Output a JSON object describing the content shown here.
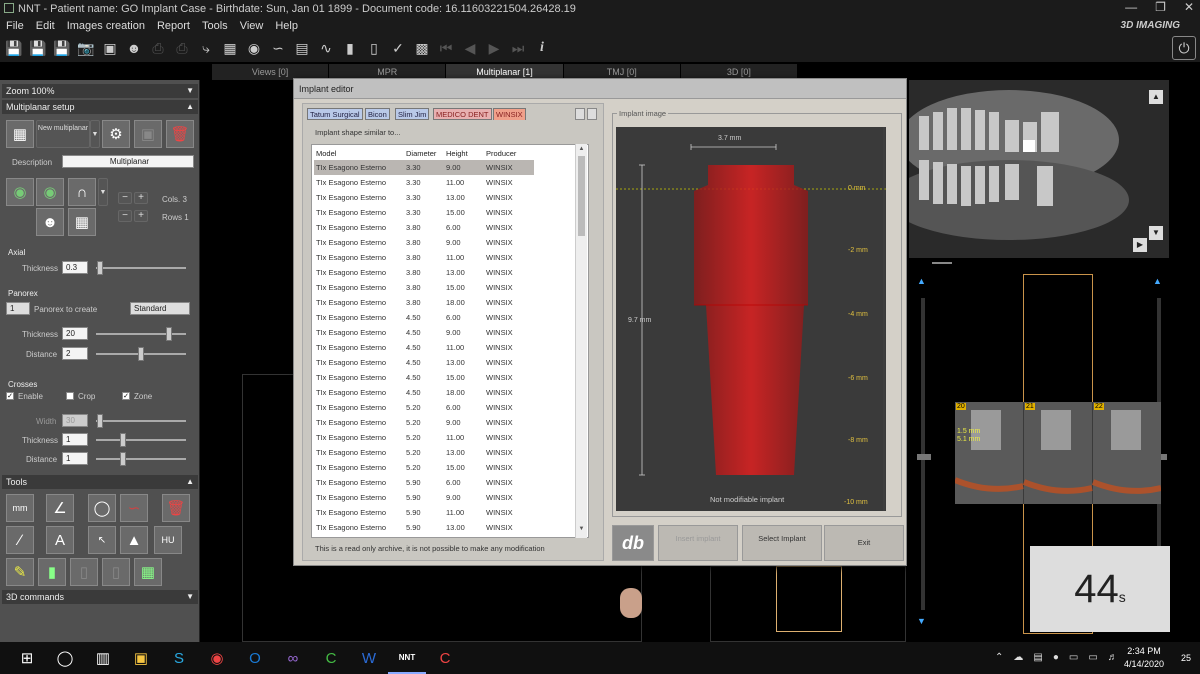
{
  "window": {
    "title": "NNT - Patient name: GO Implant Case - Birthdate: Sun, Jan 01 1899 - Document code: 16.11603221504.26428.19",
    "brand": "3D IMAGING",
    "minimize": "—",
    "restore": "❐",
    "close": "✕"
  },
  "menu": [
    "File",
    "Edit",
    "Images creation",
    "Report",
    "Tools",
    "View",
    "Help"
  ],
  "view_tabs": [
    "Views [0]",
    "MPR",
    "Multiplanar [1]",
    "TMJ [0]",
    "3D [0]"
  ],
  "left_panel": {
    "zoom": "Zoom 100%",
    "multiplanar_setup": "Multiplanar setup",
    "new_multiplanar": "New multiplanar",
    "description_label": "Description",
    "description_value": "Multiplanar",
    "cols_label": "Cols.",
    "cols_value": "3",
    "rows_label": "Rows",
    "rows_value": "1",
    "axial": "Axial",
    "thickness_label": "Thickness",
    "axial_thickness": "0.3",
    "panorex": "Panorex",
    "panorex_count": "1",
    "panorex_to_create": "Panorex to create",
    "panorex_type": "Standard",
    "panorex_thickness": "20",
    "distance_label": "Distance",
    "panorex_distance": "2",
    "crosses": "Crosses",
    "enable": "Enable",
    "crop": "Crop",
    "zone": "Zone",
    "width_label": "Width",
    "crosses_width": "30",
    "crosses_thickness": "1",
    "crosses_distance": "1",
    "tools": "Tools",
    "commands_3d": "3D commands"
  },
  "dialog": {
    "title": "Implant editor",
    "brand_tabs": [
      {
        "label": "Tatum Surgical",
        "color": "#b9c9e8"
      },
      {
        "label": "Bicon",
        "color": "#b9c9e8"
      },
      {
        "label": "Slim Jim",
        "color": "#b9c9e8"
      },
      {
        "label": "MEDICO DENT",
        "color": "#e8b0b0"
      },
      {
        "label": "WINSIX",
        "color": "#f0a08a"
      }
    ],
    "shape_label": "Implant shape similar to...",
    "columns": [
      "Model",
      "Diameter",
      "Height",
      "Producer"
    ],
    "rows": [
      [
        "TIx Esagono Esterno",
        "3.30",
        "9.00",
        "WINSIX"
      ],
      [
        "TIx Esagono Esterno",
        "3.30",
        "11.00",
        "WINSIX"
      ],
      [
        "TIx Esagono Esterno",
        "3.30",
        "13.00",
        "WINSIX"
      ],
      [
        "TIx Esagono Esterno",
        "3.30",
        "15.00",
        "WINSIX"
      ],
      [
        "TIx Esagono Esterno",
        "3.80",
        "6.00",
        "WINSIX"
      ],
      [
        "TIx Esagono Esterno",
        "3.80",
        "9.00",
        "WINSIX"
      ],
      [
        "TIx Esagono Esterno",
        "3.80",
        "11.00",
        "WINSIX"
      ],
      [
        "TIx Esagono Esterno",
        "3.80",
        "13.00",
        "WINSIX"
      ],
      [
        "TIx Esagono Esterno",
        "3.80",
        "15.00",
        "WINSIX"
      ],
      [
        "TIx Esagono Esterno",
        "3.80",
        "18.00",
        "WINSIX"
      ],
      [
        "TIx Esagono Esterno",
        "4.50",
        "6.00",
        "WINSIX"
      ],
      [
        "TIx Esagono Esterno",
        "4.50",
        "9.00",
        "WINSIX"
      ],
      [
        "TIx Esagono Esterno",
        "4.50",
        "11.00",
        "WINSIX"
      ],
      [
        "TIx Esagono Esterno",
        "4.50",
        "13.00",
        "WINSIX"
      ],
      [
        "TIx Esagono Esterno",
        "4.50",
        "15.00",
        "WINSIX"
      ],
      [
        "TIx Esagono Esterno",
        "4.50",
        "18.00",
        "WINSIX"
      ],
      [
        "TIx Esagono Esterno",
        "5.20",
        "6.00",
        "WINSIX"
      ],
      [
        "TIx Esagono Esterno",
        "5.20",
        "9.00",
        "WINSIX"
      ],
      [
        "TIx Esagono Esterno",
        "5.20",
        "11.00",
        "WINSIX"
      ],
      [
        "TIx Esagono Esterno",
        "5.20",
        "13.00",
        "WINSIX"
      ],
      [
        "TIx Esagono Esterno",
        "5.20",
        "15.00",
        "WINSIX"
      ],
      [
        "TIx Esagono Esterno",
        "5.90",
        "6.00",
        "WINSIX"
      ],
      [
        "TIx Esagono Esterno",
        "5.90",
        "9.00",
        "WINSIX"
      ],
      [
        "TIx Esagono Esterno",
        "5.90",
        "11.00",
        "WINSIX"
      ],
      [
        "TIx Esagono Esterno",
        "5.90",
        "13.00",
        "WINSIX"
      ]
    ],
    "readonly_note": "This is a read only archive, it is not possible to make any modification",
    "image_group": "Implant image",
    "diameter_dim": "3.7 mm",
    "height_dim": "9.7 mm",
    "scale_ticks": [
      "0 mm",
      "-2 mm",
      "-4 mm",
      "-6 mm",
      "-8 mm",
      "-10 mm"
    ],
    "not_modifiable": "Not modifiable implant",
    "db_label": "db",
    "insert_label": "Insert implant",
    "select_label": "Select Implant",
    "exit_label": "Exit"
  },
  "cross_labels": [
    "20",
    "21",
    "22"
  ],
  "cross_measure": [
    "1.5 mm",
    "5.1 mm"
  ],
  "timer": {
    "value": "44",
    "unit": "s"
  },
  "clock": {
    "time": "2:34 PM",
    "date": "4/14/2020"
  },
  "notification_count": "25",
  "taskbar_nnt": "NNT"
}
